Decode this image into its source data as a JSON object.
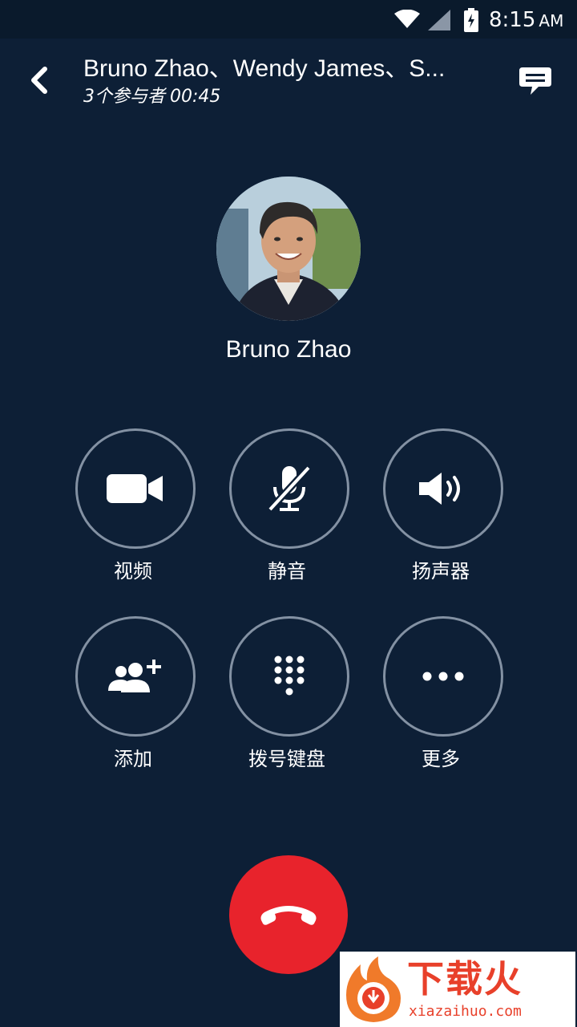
{
  "status_bar": {
    "time": "8:15",
    "ampm": "AM",
    "icons": [
      "wifi-icon",
      "signal-icon",
      "battery-charging-icon"
    ]
  },
  "header": {
    "title": "Bruno Zhao、Wendy James、S...",
    "participants": "3个参与者",
    "duration": "00:45",
    "back_icon": "chevron-left-icon",
    "chat_icon": "chat-bubble-icon"
  },
  "caller": {
    "name": "Bruno Zhao",
    "avatar": "profile-photo"
  },
  "controls": [
    {
      "label": "视频",
      "icon": "video-camera-icon"
    },
    {
      "label": "静音",
      "icon": "microphone-muted-icon"
    },
    {
      "label": "扬声器",
      "icon": "speaker-icon"
    },
    {
      "label": "添加",
      "icon": "add-people-icon"
    },
    {
      "label": "拨号键盘",
      "icon": "dialpad-icon"
    },
    {
      "label": "更多",
      "icon": "more-icon"
    }
  ],
  "hangup": {
    "icon": "phone-hangup-icon"
  },
  "watermark": {
    "title": "下载火",
    "url": "xiazaihuo.com"
  },
  "colors": {
    "background": "#0d1f36",
    "status_bar": "#0a1a2c",
    "button_border": "#8391a3",
    "hangup": "#e8232c",
    "watermark_brand": "#e8402a"
  }
}
